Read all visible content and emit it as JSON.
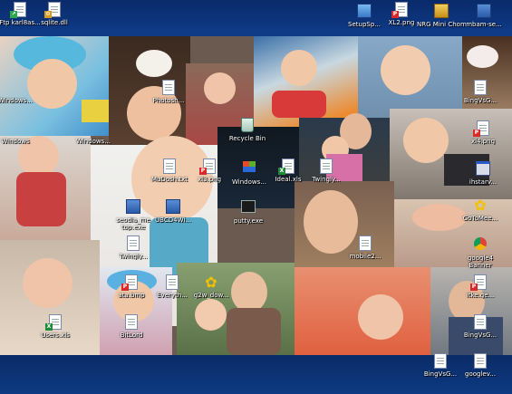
{
  "desktop": {
    "icons": [
      {
        "id": "ftp",
        "label": "Ftp karl8as...",
        "icon": "shortcut-icon"
      },
      {
        "id": "sqlite",
        "label": "sqlite.dll",
        "icon": "dll-file-icon"
      },
      {
        "id": "setupsp",
        "label": "SetupSp...",
        "icon": "setup-icon"
      },
      {
        "id": "xl2",
        "label": "XL2.png",
        "icon": "image-file-icon"
      },
      {
        "id": "nrg",
        "label": "NRG Mini Chome V...",
        "icon": "nrg-icon"
      },
      {
        "id": "mbam",
        "label": "mbam-se...",
        "icon": "program-icon"
      },
      {
        "id": "windows1",
        "label": "Windows...",
        "icon": "folder-icon"
      },
      {
        "id": "photosh",
        "label": "Photosh...",
        "icon": "document-icon"
      },
      {
        "id": "bingvsg1",
        "label": "BingVsG...",
        "icon": "document-icon"
      },
      {
        "id": "windows2",
        "label": "Windows",
        "icon": "folder-icon"
      },
      {
        "id": "windows3",
        "label": "Windows...",
        "icon": "folder-icon"
      },
      {
        "id": "recycle",
        "label": "Recycle Bin",
        "icon": "recycle-bin-icon"
      },
      {
        "id": "xl4",
        "label": "xl4.png",
        "icon": "image-file-icon"
      },
      {
        "id": "mudosh",
        "label": "MuDosh.txt",
        "icon": "text-file-icon"
      },
      {
        "id": "xl3",
        "label": "xl3.png",
        "icon": "image-file-icon"
      },
      {
        "id": "windows4",
        "label": "Windows...",
        "icon": "windows-flag-icon"
      },
      {
        "id": "ideal",
        "label": "Ideal.xls",
        "icon": "excel-file-icon"
      },
      {
        "id": "twingly1",
        "label": "Twingly...",
        "icon": "document-icon"
      },
      {
        "id": "ihstar",
        "label": "ihstarv...",
        "icon": "window-icon"
      },
      {
        "id": "seodiamond",
        "label": "seodia_me top.exe",
        "icon": "exe-icon"
      },
      {
        "id": "ubcd",
        "label": "UBCD4Wi...",
        "icon": "exe-icon"
      },
      {
        "id": "putty",
        "label": "putty.exe",
        "icon": "terminal-icon"
      },
      {
        "id": "gotomee",
        "label": "GoToMee...",
        "icon": "flower-icon"
      },
      {
        "id": "twingly2",
        "label": "Twingly...",
        "icon": "document-icon"
      },
      {
        "id": "mobile2",
        "label": "mobile2...",
        "icon": "document-icon"
      },
      {
        "id": "google4",
        "label": "google4 Banner",
        "icon": "chrome-icon"
      },
      {
        "id": "ata",
        "label": "ata.bmp",
        "icon": "image-file-icon"
      },
      {
        "id": "everyth",
        "label": "Everyth...",
        "icon": "document-icon"
      },
      {
        "id": "g2w",
        "label": "g2w_dow...",
        "icon": "flower-icon"
      },
      {
        "id": "itke",
        "label": "itke.ge...",
        "icon": "image-file-icon"
      },
      {
        "id": "users",
        "label": "Users.xls",
        "icon": "excel-file-icon"
      },
      {
        "id": "bitlord",
        "label": "BitLord",
        "icon": "document-icon"
      },
      {
        "id": "bingvsg2",
        "label": "BingVsG...",
        "icon": "document-icon"
      },
      {
        "id": "bingvsg3",
        "label": "BingVsG...",
        "icon": "document-icon"
      },
      {
        "id": "googlev",
        "label": "googlev...",
        "icon": "document-icon"
      }
    ]
  }
}
